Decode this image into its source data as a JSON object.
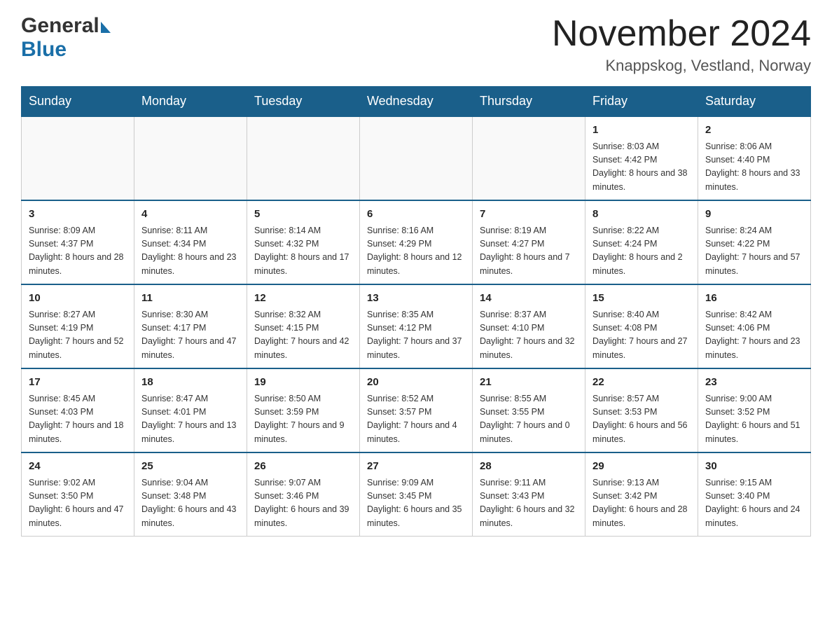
{
  "header": {
    "logo_general": "General",
    "logo_blue": "Blue",
    "month_title": "November 2024",
    "location": "Knappskog, Vestland, Norway"
  },
  "days_of_week": [
    "Sunday",
    "Monday",
    "Tuesday",
    "Wednesday",
    "Thursday",
    "Friday",
    "Saturday"
  ],
  "weeks": [
    [
      {
        "day": "",
        "info": ""
      },
      {
        "day": "",
        "info": ""
      },
      {
        "day": "",
        "info": ""
      },
      {
        "day": "",
        "info": ""
      },
      {
        "day": "",
        "info": ""
      },
      {
        "day": "1",
        "info": "Sunrise: 8:03 AM\nSunset: 4:42 PM\nDaylight: 8 hours and 38 minutes."
      },
      {
        "day": "2",
        "info": "Sunrise: 8:06 AM\nSunset: 4:40 PM\nDaylight: 8 hours and 33 minutes."
      }
    ],
    [
      {
        "day": "3",
        "info": "Sunrise: 8:09 AM\nSunset: 4:37 PM\nDaylight: 8 hours and 28 minutes."
      },
      {
        "day": "4",
        "info": "Sunrise: 8:11 AM\nSunset: 4:34 PM\nDaylight: 8 hours and 23 minutes."
      },
      {
        "day": "5",
        "info": "Sunrise: 8:14 AM\nSunset: 4:32 PM\nDaylight: 8 hours and 17 minutes."
      },
      {
        "day": "6",
        "info": "Sunrise: 8:16 AM\nSunset: 4:29 PM\nDaylight: 8 hours and 12 minutes."
      },
      {
        "day": "7",
        "info": "Sunrise: 8:19 AM\nSunset: 4:27 PM\nDaylight: 8 hours and 7 minutes."
      },
      {
        "day": "8",
        "info": "Sunrise: 8:22 AM\nSunset: 4:24 PM\nDaylight: 8 hours and 2 minutes."
      },
      {
        "day": "9",
        "info": "Sunrise: 8:24 AM\nSunset: 4:22 PM\nDaylight: 7 hours and 57 minutes."
      }
    ],
    [
      {
        "day": "10",
        "info": "Sunrise: 8:27 AM\nSunset: 4:19 PM\nDaylight: 7 hours and 52 minutes."
      },
      {
        "day": "11",
        "info": "Sunrise: 8:30 AM\nSunset: 4:17 PM\nDaylight: 7 hours and 47 minutes."
      },
      {
        "day": "12",
        "info": "Sunrise: 8:32 AM\nSunset: 4:15 PM\nDaylight: 7 hours and 42 minutes."
      },
      {
        "day": "13",
        "info": "Sunrise: 8:35 AM\nSunset: 4:12 PM\nDaylight: 7 hours and 37 minutes."
      },
      {
        "day": "14",
        "info": "Sunrise: 8:37 AM\nSunset: 4:10 PM\nDaylight: 7 hours and 32 minutes."
      },
      {
        "day": "15",
        "info": "Sunrise: 8:40 AM\nSunset: 4:08 PM\nDaylight: 7 hours and 27 minutes."
      },
      {
        "day": "16",
        "info": "Sunrise: 8:42 AM\nSunset: 4:06 PM\nDaylight: 7 hours and 23 minutes."
      }
    ],
    [
      {
        "day": "17",
        "info": "Sunrise: 8:45 AM\nSunset: 4:03 PM\nDaylight: 7 hours and 18 minutes."
      },
      {
        "day": "18",
        "info": "Sunrise: 8:47 AM\nSunset: 4:01 PM\nDaylight: 7 hours and 13 minutes."
      },
      {
        "day": "19",
        "info": "Sunrise: 8:50 AM\nSunset: 3:59 PM\nDaylight: 7 hours and 9 minutes."
      },
      {
        "day": "20",
        "info": "Sunrise: 8:52 AM\nSunset: 3:57 PM\nDaylight: 7 hours and 4 minutes."
      },
      {
        "day": "21",
        "info": "Sunrise: 8:55 AM\nSunset: 3:55 PM\nDaylight: 7 hours and 0 minutes."
      },
      {
        "day": "22",
        "info": "Sunrise: 8:57 AM\nSunset: 3:53 PM\nDaylight: 6 hours and 56 minutes."
      },
      {
        "day": "23",
        "info": "Sunrise: 9:00 AM\nSunset: 3:52 PM\nDaylight: 6 hours and 51 minutes."
      }
    ],
    [
      {
        "day": "24",
        "info": "Sunrise: 9:02 AM\nSunset: 3:50 PM\nDaylight: 6 hours and 47 minutes."
      },
      {
        "day": "25",
        "info": "Sunrise: 9:04 AM\nSunset: 3:48 PM\nDaylight: 6 hours and 43 minutes."
      },
      {
        "day": "26",
        "info": "Sunrise: 9:07 AM\nSunset: 3:46 PM\nDaylight: 6 hours and 39 minutes."
      },
      {
        "day": "27",
        "info": "Sunrise: 9:09 AM\nSunset: 3:45 PM\nDaylight: 6 hours and 35 minutes."
      },
      {
        "day": "28",
        "info": "Sunrise: 9:11 AM\nSunset: 3:43 PM\nDaylight: 6 hours and 32 minutes."
      },
      {
        "day": "29",
        "info": "Sunrise: 9:13 AM\nSunset: 3:42 PM\nDaylight: 6 hours and 28 minutes."
      },
      {
        "day": "30",
        "info": "Sunrise: 9:15 AM\nSunset: 3:40 PM\nDaylight: 6 hours and 24 minutes."
      }
    ]
  ]
}
